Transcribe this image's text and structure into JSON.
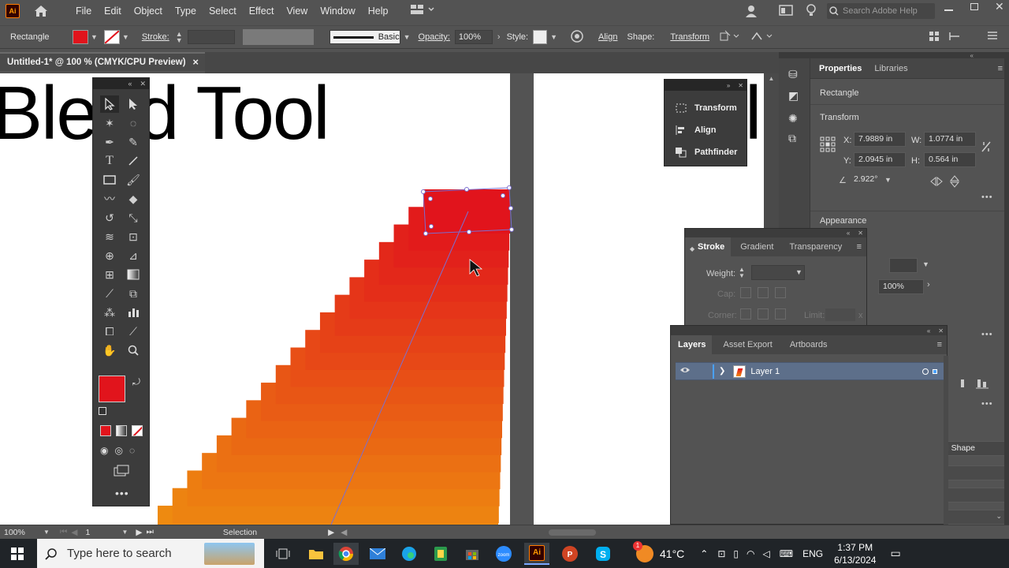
{
  "menu": {
    "logo": "Ai",
    "items": [
      "File",
      "Edit",
      "Object",
      "Type",
      "Select",
      "Effect",
      "View",
      "Window",
      "Help"
    ],
    "search_placeholder": "Search Adobe Help"
  },
  "control_bar": {
    "object_type": "Rectangle",
    "fill_color": "#e1141c",
    "stroke_label": "Stroke:",
    "brush_label": "Basic",
    "opacity_label": "Opacity:",
    "opacity_value": "100%",
    "style_label": "Style:",
    "align_label": "Align",
    "shape_label": "Shape:",
    "transform_label": "Transform"
  },
  "document_tab": {
    "title": "Untitled-1* @ 100 % (CMYK/CPU Preview)",
    "close": "×"
  },
  "artboard": {
    "heading_text": "Blend Tool",
    "right_fragment": "l",
    "blend": {
      "start_color": "#e1141c",
      "end_color": "#ee8a10",
      "steps": 19
    }
  },
  "floating_panel": {
    "items": [
      "Transform",
      "Align",
      "Pathfinder"
    ]
  },
  "properties": {
    "tabs": [
      "Properties",
      "Libraries"
    ],
    "object": "Rectangle",
    "transform_title": "Transform",
    "x_label": "X:",
    "x_value": "7.9889 in",
    "y_label": "Y:",
    "y_value": "2.0945 in",
    "w_label": "W:",
    "w_value": "1.0774 in",
    "h_label": "H:",
    "h_value": "0.564 in",
    "angle_value": "2.922°",
    "appearance_title": "Appearance",
    "opacity_value": "100%",
    "partial_button": "nd Shape"
  },
  "stroke_panel": {
    "tabs": [
      "Stroke",
      "Gradient",
      "Transparency"
    ],
    "weight_label": "Weight:",
    "cap_label": "Cap:",
    "corner_label": "Corner:",
    "limit_label": "Limit:",
    "limit_suffix": "x"
  },
  "layers_panel": {
    "tabs": [
      "Layers",
      "Asset Export",
      "Artboards"
    ],
    "layer_name": "Layer 1"
  },
  "status_bar": {
    "zoom": "100%",
    "artboard_number": "1",
    "tool_name": "Selection"
  },
  "taskbar": {
    "search_placeholder": "Type here to search",
    "temperature": "41°C",
    "language": "ENG",
    "time": "1:37 PM",
    "date": "6/13/2024",
    "weather_badge": "1"
  }
}
